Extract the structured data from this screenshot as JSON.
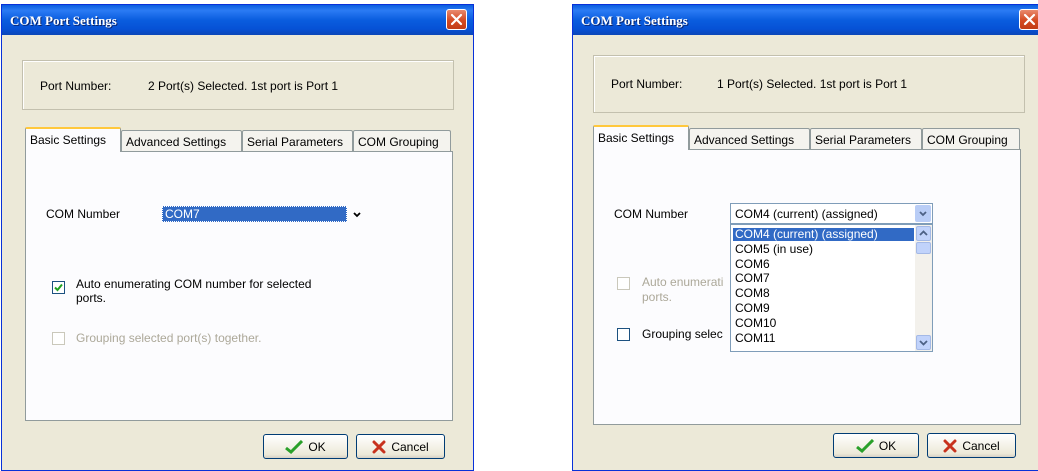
{
  "left_dialog": {
    "title": "COM Port Settings",
    "port_number_label": "Port Number:",
    "port_number_value": "2 Port(s) Selected. 1st port is Port 1",
    "tabs": [
      "Basic Settings",
      "Advanced Settings",
      "Serial Parameters",
      "COM Grouping"
    ],
    "com_number_label": "COM Number",
    "com_number_value": "COM7",
    "auto_enum_label_line1": "Auto enumerating COM number for selected",
    "auto_enum_label_line2": "ports.",
    "auto_enum_checked": true,
    "grouping_label": "Grouping selected port(s) together.",
    "grouping_checked": false,
    "ok_label": "OK",
    "cancel_label": "Cancel"
  },
  "right_dialog": {
    "title": "COM Port Settings",
    "port_number_label": "Port Number:",
    "port_number_value": "1 Port(s) Selected. 1st port is Port 1",
    "tabs": [
      "Basic Settings",
      "Advanced Settings",
      "Serial Parameters",
      "COM Grouping"
    ],
    "com_number_label": "COM Number",
    "com_number_value": "COM4 (current) (assigned)",
    "dropdown_options": [
      "COM4 (current) (assigned)",
      "COM5 (in use)",
      "COM6",
      "COM7",
      "COM8",
      "COM9",
      "COM10",
      "COM11"
    ],
    "auto_enum_label_partial": "Auto enumerati",
    "auto_enum_label_line2": "ports.",
    "grouping_label_partial": "Grouping selec",
    "ok_label": "OK",
    "cancel_label": "Cancel"
  },
  "colors": {
    "titlebar_blue": "#0a5ddf",
    "dialog_face": "#ece9d8",
    "selection": "#316ac5",
    "ok_check": "#2aa02a",
    "cancel_x": "#c8321e"
  }
}
